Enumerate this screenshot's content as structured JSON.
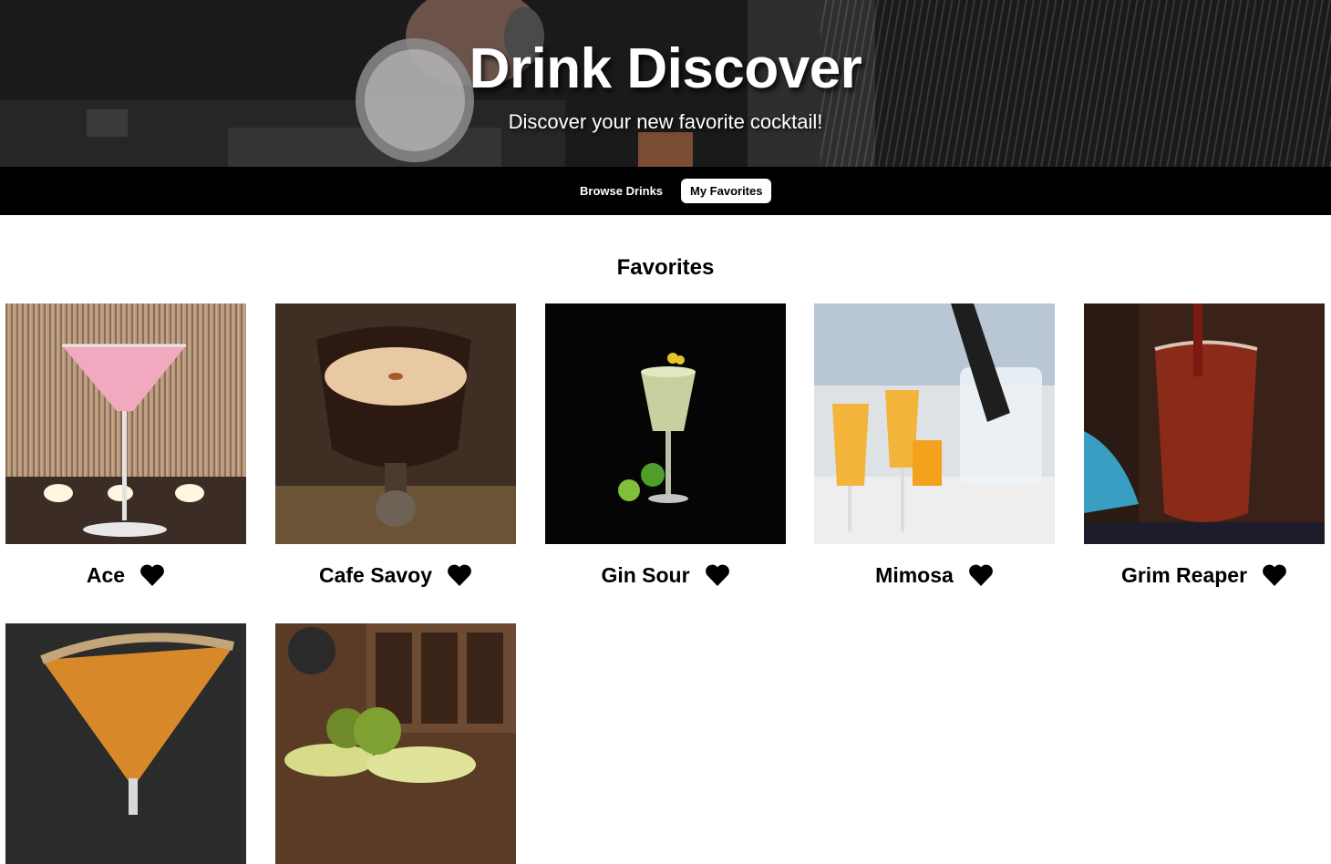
{
  "hero": {
    "title": "Drink Discover",
    "subtitle": "Discover your new favorite cocktail!"
  },
  "nav": {
    "browse_label": "Browse Drinks",
    "favorites_label": "My Favorites",
    "active": "favorites"
  },
  "favorites": {
    "heading": "Favorites",
    "drinks": [
      {
        "name": "Ace",
        "favorited": true
      },
      {
        "name": "Cafe Savoy",
        "favorited": true
      },
      {
        "name": "Gin Sour",
        "favorited": true
      },
      {
        "name": "Mimosa",
        "favorited": true
      },
      {
        "name": "Grim Reaper",
        "favorited": true
      },
      {
        "name": "",
        "favorited": true
      },
      {
        "name": "",
        "favorited": true
      }
    ]
  },
  "colors": {
    "nav_bg": "#000000",
    "heart": "#000000",
    "active_pill": "#ffffff"
  },
  "icons": {
    "favorite": "heart-icon"
  }
}
